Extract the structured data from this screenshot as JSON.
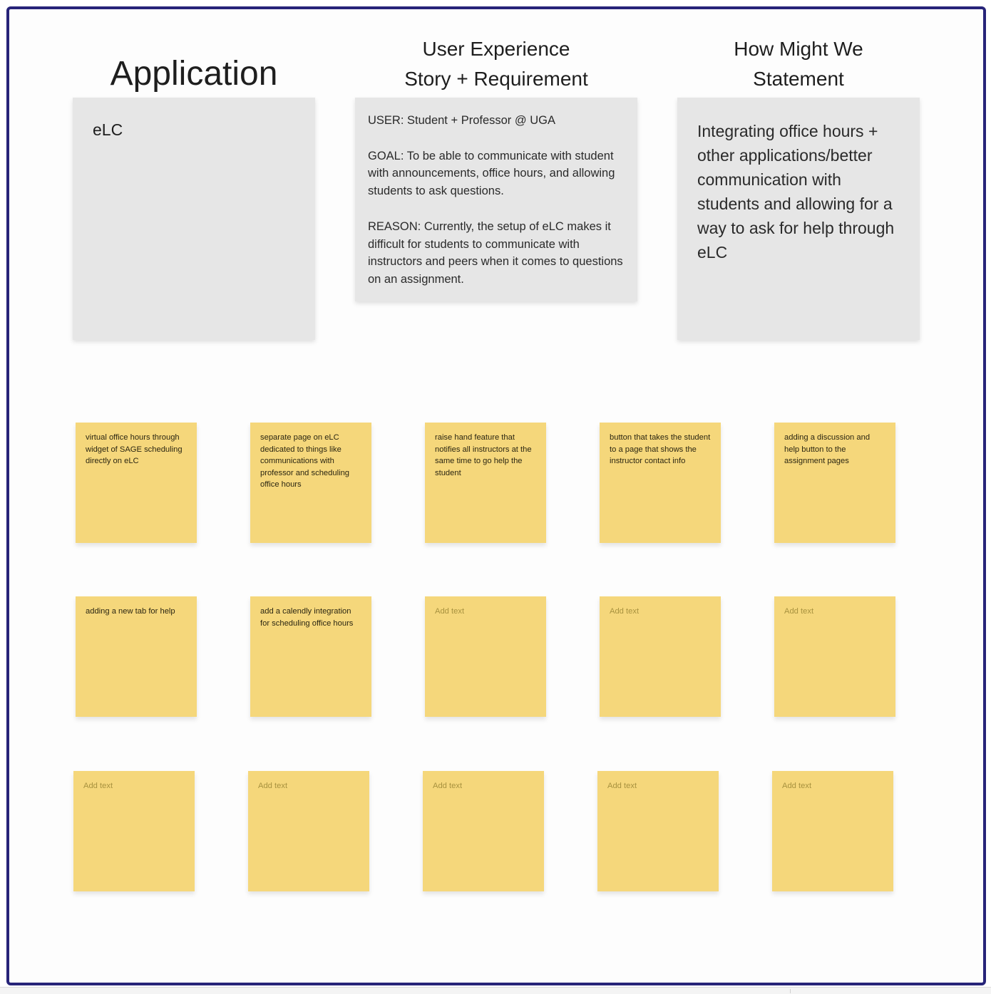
{
  "board": {
    "frame_color": "#272479",
    "sticky_color": "#f5d77b",
    "card_color": "#e6e6e6"
  },
  "columns": {
    "application": {
      "heading": "Application",
      "content": "eLC"
    },
    "user_experience": {
      "heading_line1": "User Experience",
      "heading_line2": "Story + Requirement",
      "user": "USER: Student + Professor @ UGA",
      "goal": "GOAL: To be able to communicate with student with announcements, office hours, and allowing students to ask questions.",
      "reason": "REASON: Currently, the setup of eLC makes it difficult for students to communicate with instructors and peers when it comes to questions on an assignment."
    },
    "how_might_we": {
      "heading_line1": "How Might We",
      "heading_line2": "Statement",
      "content": "Integrating office hours + other applications/better communication with students and allowing for a way to ask for help through eLC"
    }
  },
  "stickies": [
    {
      "text": "virtual office hours through widget of SAGE scheduling directly on eLC",
      "placeholder": false
    },
    {
      "text": "separate page on eLC dedicated to things like communications with professor and scheduling office hours",
      "placeholder": false
    },
    {
      "text": "raise hand feature that notifies all instructors at the same time to go help the student",
      "placeholder": false
    },
    {
      "text": "button that takes the student to a page that shows the instructor contact info",
      "placeholder": false
    },
    {
      "text": "adding a discussion and help button to the assignment pages",
      "placeholder": false
    },
    {
      "text": "adding a new tab for help",
      "placeholder": false
    },
    {
      "text": "add a calendly integration for scheduling office hours",
      "placeholder": false
    },
    {
      "text": "Add text",
      "placeholder": true
    },
    {
      "text": "Add text",
      "placeholder": true
    },
    {
      "text": "Add text",
      "placeholder": true
    },
    {
      "text": "Add text",
      "placeholder": true
    },
    {
      "text": "Add text",
      "placeholder": true
    },
    {
      "text": "Add text",
      "placeholder": true
    },
    {
      "text": "Add text",
      "placeholder": true
    },
    {
      "text": "Add text",
      "placeholder": true
    }
  ]
}
